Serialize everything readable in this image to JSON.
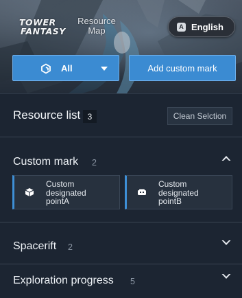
{
  "header": {
    "logo_line1": "TOWER",
    "logo_line2": "FANTASY",
    "logo_sub_line1": "Resource",
    "logo_sub_line2": "Map",
    "language_label": "English",
    "language_icon_letter": "A"
  },
  "toolbar": {
    "filter_label": "All",
    "add_label": "Add custom mark"
  },
  "resource_list": {
    "title": "Resource list",
    "count": "3",
    "clean_label": "Clean Selction"
  },
  "sections": [
    {
      "title": "Custom mark",
      "count": "2",
      "expanded": true,
      "items": [
        {
          "label_lines": [
            "Custom",
            "designated",
            "pointA"
          ],
          "icon": "cube-icon"
        },
        {
          "label_lines": [
            "Custom",
            "designated",
            "pointB"
          ],
          "icon": "chest-icon"
        }
      ]
    },
    {
      "title": "Spacerift",
      "count": "2",
      "expanded": false
    },
    {
      "title": "Exploration progress",
      "count": "5",
      "expanded": false
    }
  ],
  "colors": {
    "accent": "#3b8bd2",
    "panel_bg": "#1c2532",
    "card_bg": "#27313e"
  }
}
